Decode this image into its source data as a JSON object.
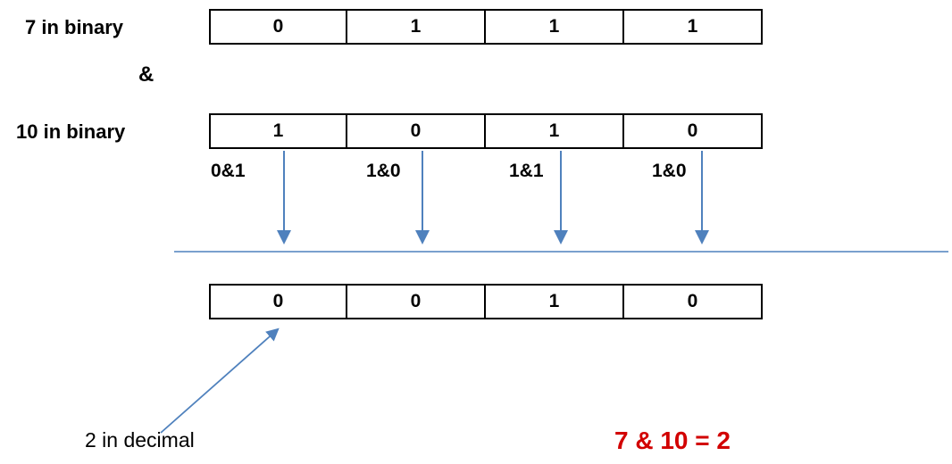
{
  "operand_a": {
    "label": "7 in binary",
    "bits": [
      "0",
      "1",
      "1",
      "1"
    ]
  },
  "operator_symbol": "&",
  "operand_b": {
    "label": "10 in binary",
    "bits": [
      "1",
      "0",
      "1",
      "0"
    ]
  },
  "bit_ops": [
    "0&1",
    "1&0",
    "1&1",
    "1&0"
  ],
  "result": {
    "bits": [
      "0",
      "0",
      "1",
      "0"
    ],
    "decimal_label": "2 in decimal",
    "expression": "7 & 10 = 2"
  }
}
